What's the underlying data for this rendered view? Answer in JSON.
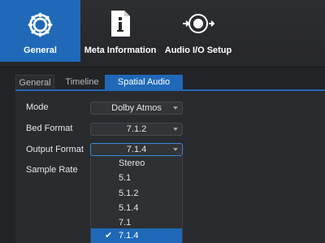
{
  "toolbar": {
    "general_label": "General",
    "meta_label": "Meta Information",
    "audio_label": "Audio I/O Setup",
    "accent": "#1f69b8"
  },
  "tabs": {
    "general": "General",
    "timeline": "Timeline",
    "spatial": "Spatial Audio"
  },
  "form": {
    "mode_label": "Mode",
    "mode_value": "Dolby Atmos",
    "bed_label": "Bed Format",
    "bed_value": "7.1.2",
    "output_label": "Output Format",
    "output_value": "7.1.4",
    "sample_label": "Sample Rate"
  },
  "dropdown": {
    "options": [
      "Stereo",
      "5.1",
      "5.1.2",
      "5.1.4",
      "7.1",
      "7.1.4"
    ],
    "selected": "7.1.4",
    "check": "✔"
  }
}
